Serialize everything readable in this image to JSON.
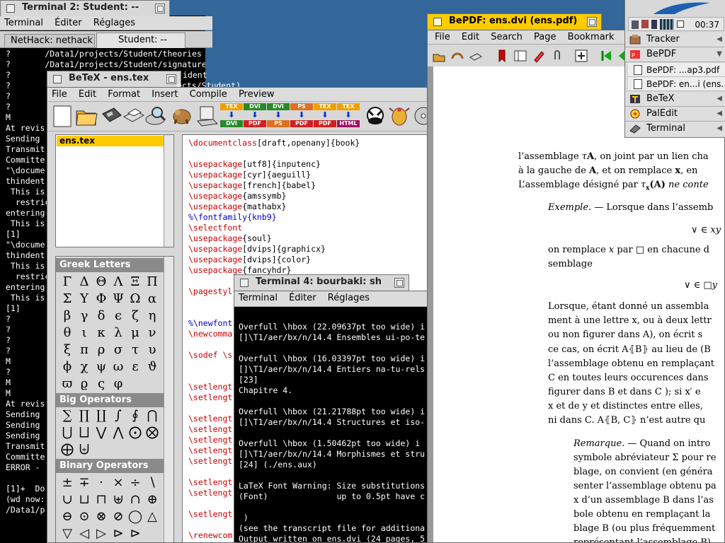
{
  "terminal2": {
    "title": "Terminal 2: Student: --",
    "menu": [
      "Terminal",
      "Éditer",
      "Réglages"
    ],
    "tabs": [
      "NetHack: nethack",
      "Student: --"
    ],
    "lines": [
      "?       /Data1/projects/Student/theories",
      "?       /Data1/projects/Student/signatures",
      "?",
      "?",
      "?",
      "?",
      "M",
      "At revis",
      "Sending",
      "Transmit",
      "Committe",
      "\"\\docume",
      "thindent",
      " This is",
      "  restric",
      "entering",
      " This is",
      "[1]",
      "\"\\docume",
      "thindent",
      " This is",
      "  restric",
      "entering",
      " This is",
      "[1]",
      "?",
      "?",
      "?",
      "?",
      "M",
      "?",
      "M",
      "M",
      "At revis",
      "Sending",
      "Sending",
      "Sending",
      "Transmit",
      "Committe",
      "ERROR -",
      "",
      "[1]+  Do",
      "(wd now:",
      "/Data1/p"
    ],
    "overlap_line1": "ident",
    "overlap_line2": "ects/Student)"
  },
  "betex": {
    "title": "BeTeX - ens.tex",
    "menu": [
      "File",
      "Edit",
      "Format",
      "Insert",
      "Compile",
      "Preview"
    ],
    "conversions": [
      {
        "from": "TEX",
        "to": "DVI"
      },
      {
        "from": "DVI",
        "to": "PDF"
      },
      {
        "from": "DVI",
        "to": "PS"
      },
      {
        "from": "PS",
        "to": "PDF"
      },
      {
        "from": "TEX",
        "to": "PDF"
      },
      {
        "from": "TEX",
        "to": "HTML"
      }
    ],
    "files": [
      "ens.tex"
    ],
    "editor_lines": [
      [
        [
          "kw",
          "\\documentclass"
        ],
        [
          "br",
          "[draft,openany]{book}"
        ]
      ],
      [],
      [
        [
          "kw",
          "\\usepackage"
        ],
        [
          "br",
          "[utf8]{inputenc}"
        ]
      ],
      [
        [
          "kw",
          "\\usepackage"
        ],
        [
          "br",
          "[cyr]{aeguill}"
        ]
      ],
      [
        [
          "kw",
          "\\usepackage"
        ],
        [
          "br",
          "[french]{babel}"
        ]
      ],
      [
        [
          "kw",
          "\\usepackage"
        ],
        [
          "br",
          "{amssymb}"
        ]
      ],
      [
        [
          "kw",
          "\\usepackage"
        ],
        [
          "br",
          "{mathabx}"
        ]
      ],
      [
        [
          "cm",
          "%\\fontfamily{knb9}"
        ]
      ],
      [
        [
          "kw",
          "\\selectfont"
        ]
      ],
      [
        [
          "kw",
          "\\usepackage"
        ],
        [
          "br",
          "{soul}"
        ]
      ],
      [
        [
          "kw",
          "\\usepackage"
        ],
        [
          "br",
          "[dvips]{graphicx}"
        ]
      ],
      [
        [
          "kw",
          "\\usepackage"
        ],
        [
          "br",
          "[dvips]{color}"
        ]
      ],
      [
        [
          "kw",
          "\\usepackage"
        ],
        [
          "br",
          "{fancyhdr}"
        ]
      ],
      [],
      [
        [
          "kw",
          "\\pagestyl"
        ]
      ],
      [],
      [],
      [
        [
          "cm",
          "%\\newfont"
        ]
      ],
      [
        [
          "kw",
          "\\newcomma"
        ]
      ],
      [],
      [
        [
          "kw",
          "\\sodef \\s"
        ]
      ],
      [],
      [],
      [
        [
          "kw",
          "\\setlengt"
        ]
      ],
      [
        [
          "kw",
          "\\setlengt"
        ]
      ],
      [],
      [
        [
          "kw",
          "\\setlengt"
        ]
      ],
      [
        [
          "kw",
          "\\setlengt"
        ]
      ],
      [
        [
          "kw",
          "\\setlengt"
        ]
      ],
      [
        [
          "kw",
          "\\setlengt"
        ]
      ],
      [
        [
          "kw",
          "\\setlengt"
        ]
      ],
      [],
      [
        [
          "kw",
          "\\setlengt"
        ]
      ],
      [
        [
          "kw",
          "\\setlengt"
        ]
      ],
      [],
      [
        [
          "kw",
          "\\setlengt"
        ]
      ],
      [],
      [
        [
          "kw",
          "\\renewcom"
        ]
      ],
      [
        [
          "kw",
          "\\renewcom"
        ]
      ]
    ],
    "palettes": {
      "greek": {
        "title": "Greek Letters",
        "symbols": [
          "Γ",
          "Δ",
          "Θ",
          "Λ",
          "Ξ",
          "Π",
          "Σ",
          "Υ",
          "Φ",
          "Ψ",
          "Ω",
          "α",
          "β",
          "γ",
          "δ",
          "ϵ",
          "ζ",
          "η",
          "θ",
          "ι",
          "κ",
          "λ",
          "μ",
          "ν",
          "ξ",
          "π",
          "ρ",
          "σ",
          "τ",
          "υ",
          "ϕ",
          "χ",
          "ψ",
          "ω",
          "ε",
          "ϑ",
          "ϖ",
          "ϱ",
          "ς",
          "φ"
        ]
      },
      "bigops": {
        "title": "Big Operators",
        "symbols": [
          "∑",
          "∏",
          "∐",
          "∫",
          "∮",
          "⋂",
          "⋃",
          "⨆",
          "⋁",
          "⋀",
          "⨀",
          "⨂",
          "⨁",
          "⨄"
        ]
      },
      "binops": {
        "title": "Binary Operators",
        "symbols": [
          "±",
          "∓",
          "·",
          "×",
          "÷",
          "∖",
          "∪",
          "⊔",
          "⊓",
          "⊎",
          "∩",
          "⊕",
          "⊖",
          "⊙",
          "⊗",
          "⊘",
          "◯",
          "△",
          "▽",
          "◁",
          "▷",
          "⊳",
          "⊳"
        ]
      }
    }
  },
  "terminal4": {
    "title": "Terminal 4: bourbaki: sh",
    "menu": [
      "Terminal",
      "Éditer",
      "Réglages"
    ],
    "lines": [
      "",
      "Overfull \\hbox (22.09637pt too wide) i",
      "[]\\T1/aer/bx/n/14.4 Ensembles ui-po-te",
      "",
      "Overfull \\hbox (16.03397pt too wide) i",
      "[]\\T1/aer/bx/n/14.4 Entiers na-tu-rels",
      "[23]",
      "Chapitre 4.",
      "",
      "Overfull \\hbox (21.21788pt too wide) i",
      "[]\\T1/aer/bx/n/14.4 Structures et iso-",
      "",
      "Overfull \\hbox (1.50462pt too wide) i",
      "[]\\T1/aer/bx/n/14.4 Morphismes et stru",
      "[24] (./ens.aux)",
      "",
      "LaTeX Font Warning: Size substitutions",
      "(Font)              up to 0.5pt have c",
      "",
      " )",
      "(see the transcript file for additiona",
      "Output written on ens.dvi (24 pages, 5"
    ]
  },
  "bepdf": {
    "title": "BePDF: ens.dvi (ens.pdf)",
    "menu": [
      "File",
      "Edit",
      "Search",
      "Page",
      "Bookmark"
    ],
    "text": {
      "l1a": "l’assemblage ",
      "l1b": "τ",
      "l1c": "A",
      "l1d": ", on joint par un lien cha",
      "l2a": "à la gauche de ",
      "l2b": "A",
      "l2c": ", et on remplace ",
      "l2d": "x",
      "l2e": ", en",
      "l3a": "L’assemblage désigné par ",
      "l3b": "τ",
      "l3c": "x",
      "l3d": "(A)",
      "l3e": " ne conte",
      "ex1": "Exemple.",
      "ex2": " — Lorsque dans l’assemb",
      "f1": "∨ ∈ xy",
      "r1": "on remplace ",
      "r1b": "x",
      "r1c": " par □ en chacune d",
      "r2": "semblage",
      "f2": "∨ ∈ □y ",
      "p1": "Lorsque, étant donné un assembla",
      "p2": "ment à une lettre x, ou à deux lettr",
      "p3": "ou non figurer dans A), on écrit s",
      "p4": "ce cas, on écrit A⦃B⦄ au lieu de (B",
      "p5": "l’assemblage obtenu en remplaçant",
      "p6": "C en toutes leurs occurences dans",
      "p7": "figurer dans B et dans C ); si x′ e",
      "p8": "x et de y et distinctes entre elles, ",
      "p9": "ni dans C. A⦃B, C⦄ n’est autre qu",
      "rem1": "Remarque.",
      "rem1b": " — Quand on intro",
      "rem2": "symbole abréviateur Σ pour re",
      "rem3": "blage, on convient (en généra",
      "rem4": "senter l’assemblage obtenu pa",
      "rem5": "x d’un assemblage B dans l’as",
      "rem6": "bole obtenu en remplaçant la",
      "rem7": "blage B (ou plus fréquemment",
      "rem8": "représentant l’assemblage B)."
    }
  },
  "deskbar": {
    "clock": "00:37",
    "items": [
      {
        "label": "Tracker"
      },
      {
        "label": "BePDF"
      },
      {
        "label": "BeTeX"
      },
      {
        "label": "PalEdit"
      },
      {
        "label": "Terminal"
      }
    ],
    "subitems": [
      "BePDF: ...ap3.pdf",
      "BePDF: en...i (ens."
    ]
  },
  "colors": {
    "tab_active": "#ffcb00",
    "desktop": "#336699",
    "tex_keyword": "#cc0000",
    "tex_comment": "#0000cc"
  }
}
